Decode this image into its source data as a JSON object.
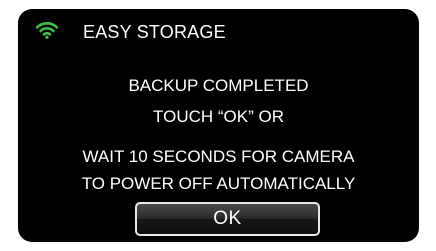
{
  "header": {
    "icon": "wifi-icon",
    "icon_color": "#3fbf4a",
    "title": "EASY STORAGE"
  },
  "message": {
    "line1": "BACKUP COMPLETED",
    "line2": "TOUCH “OK” OR",
    "line3": "WAIT 10 SECONDS FOR CAMERA",
    "line4": "TO POWER OFF AUTOMATICALLY"
  },
  "ok_button": {
    "label": "OK"
  },
  "colors": {
    "screen_background": "#000000",
    "text": "#ffffff"
  }
}
